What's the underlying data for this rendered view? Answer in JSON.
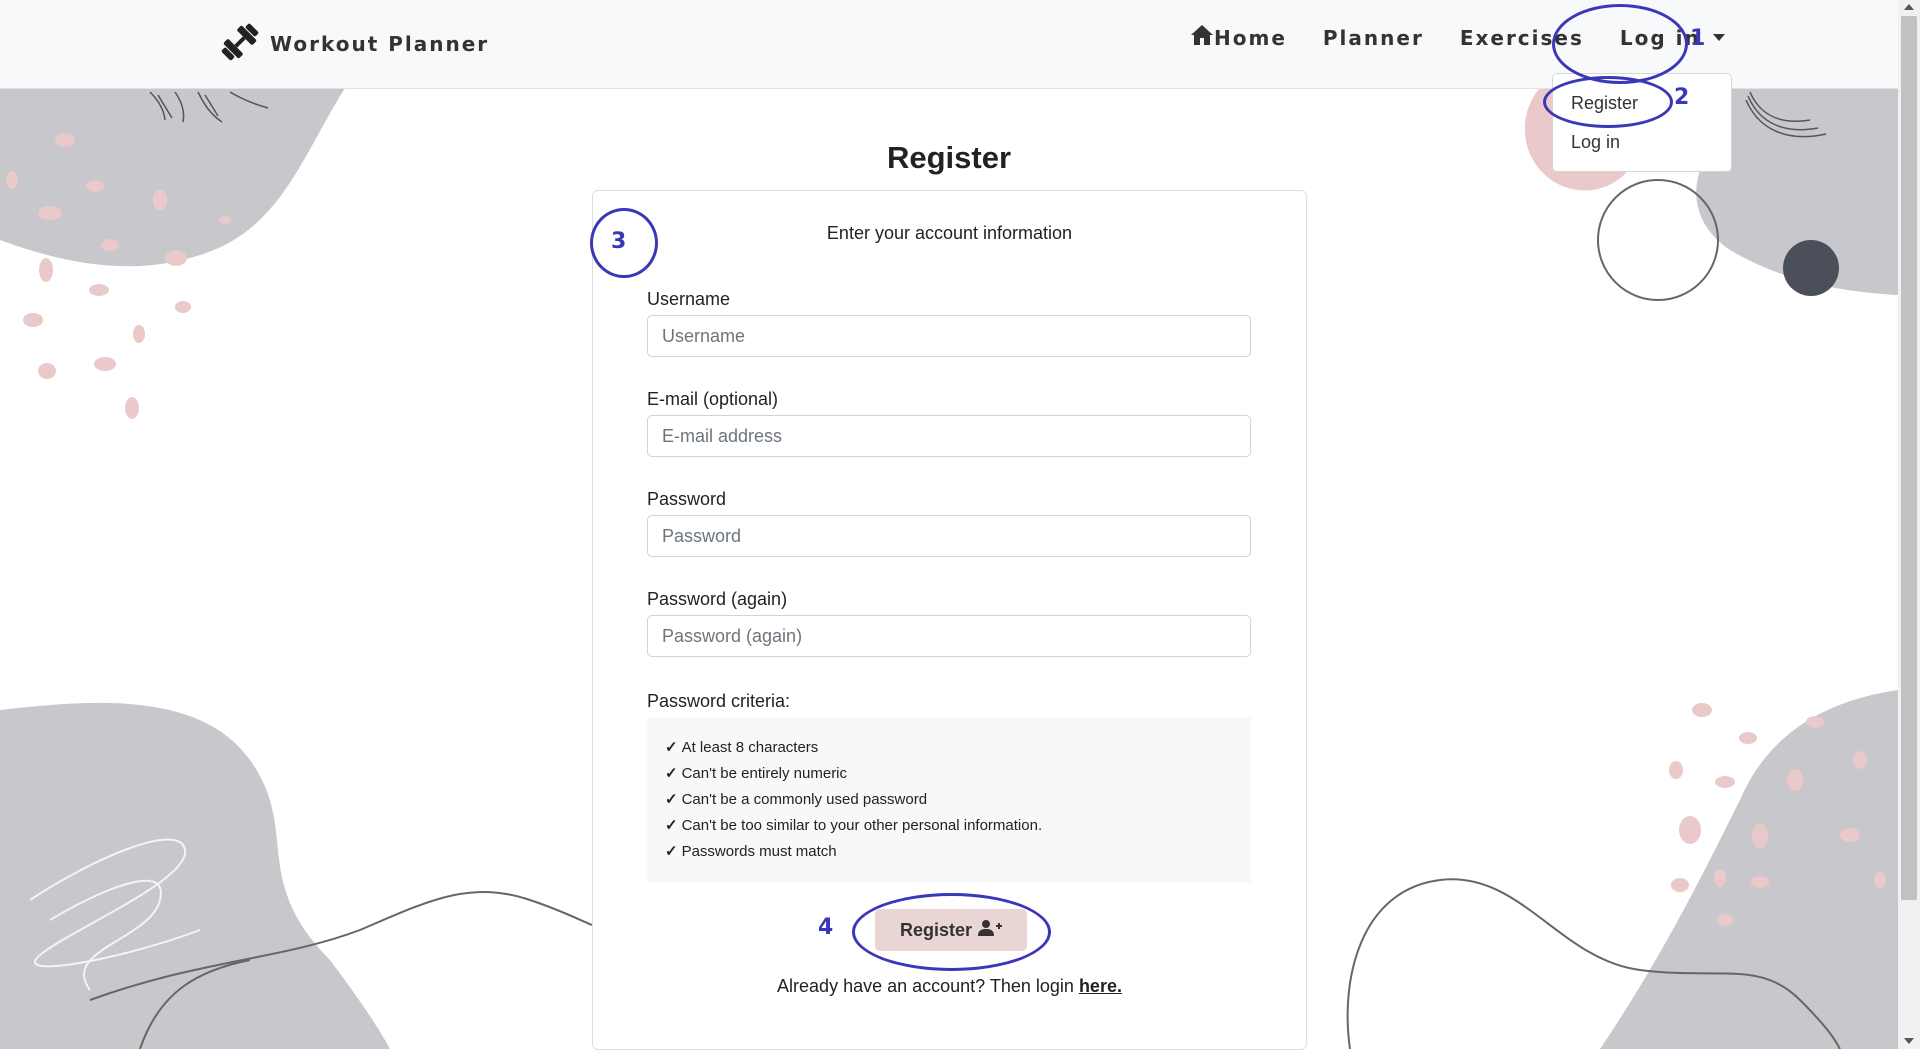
{
  "brand": {
    "name": "Workout Planner",
    "icon": "dumbbell-icon"
  },
  "nav": {
    "home_label": "Home",
    "home_icon": "home-icon",
    "planner_label": "Planner",
    "exercises_label": "Exercises",
    "login_label": "Log in"
  },
  "dropdown": {
    "items": [
      "Register",
      "Log in"
    ]
  },
  "page": {
    "title": "Register"
  },
  "form": {
    "subtitle": "Enter your account information",
    "username": {
      "label": "Username",
      "placeholder": "Username"
    },
    "email": {
      "label": "E-mail (optional)",
      "placeholder": "E-mail address"
    },
    "password": {
      "label": "Password",
      "placeholder": "Password"
    },
    "password_again": {
      "label": "Password (again)",
      "placeholder": "Password (again)"
    },
    "criteria_label": "Password criteria:",
    "criteria": [
      "At least 8 characters",
      "Can't be entirely numeric",
      "Can't be a commonly used password",
      "Can't be too similar to your other personal information.",
      "Passwords must match"
    ],
    "submit_label": "Register",
    "submit_icon": "user-plus-icon",
    "login_prompt": "Already have an account? Then login",
    "login_link": "here."
  },
  "annotations": [
    "1",
    "2",
    "3",
    "4"
  ],
  "colors": {
    "accent": "#3a37b8",
    "button_bg": "#ead5d5",
    "navbar_bg": "#f8f9fa",
    "decor_grey": "#c8c8cc",
    "decor_pink": "#e9c9c9"
  }
}
